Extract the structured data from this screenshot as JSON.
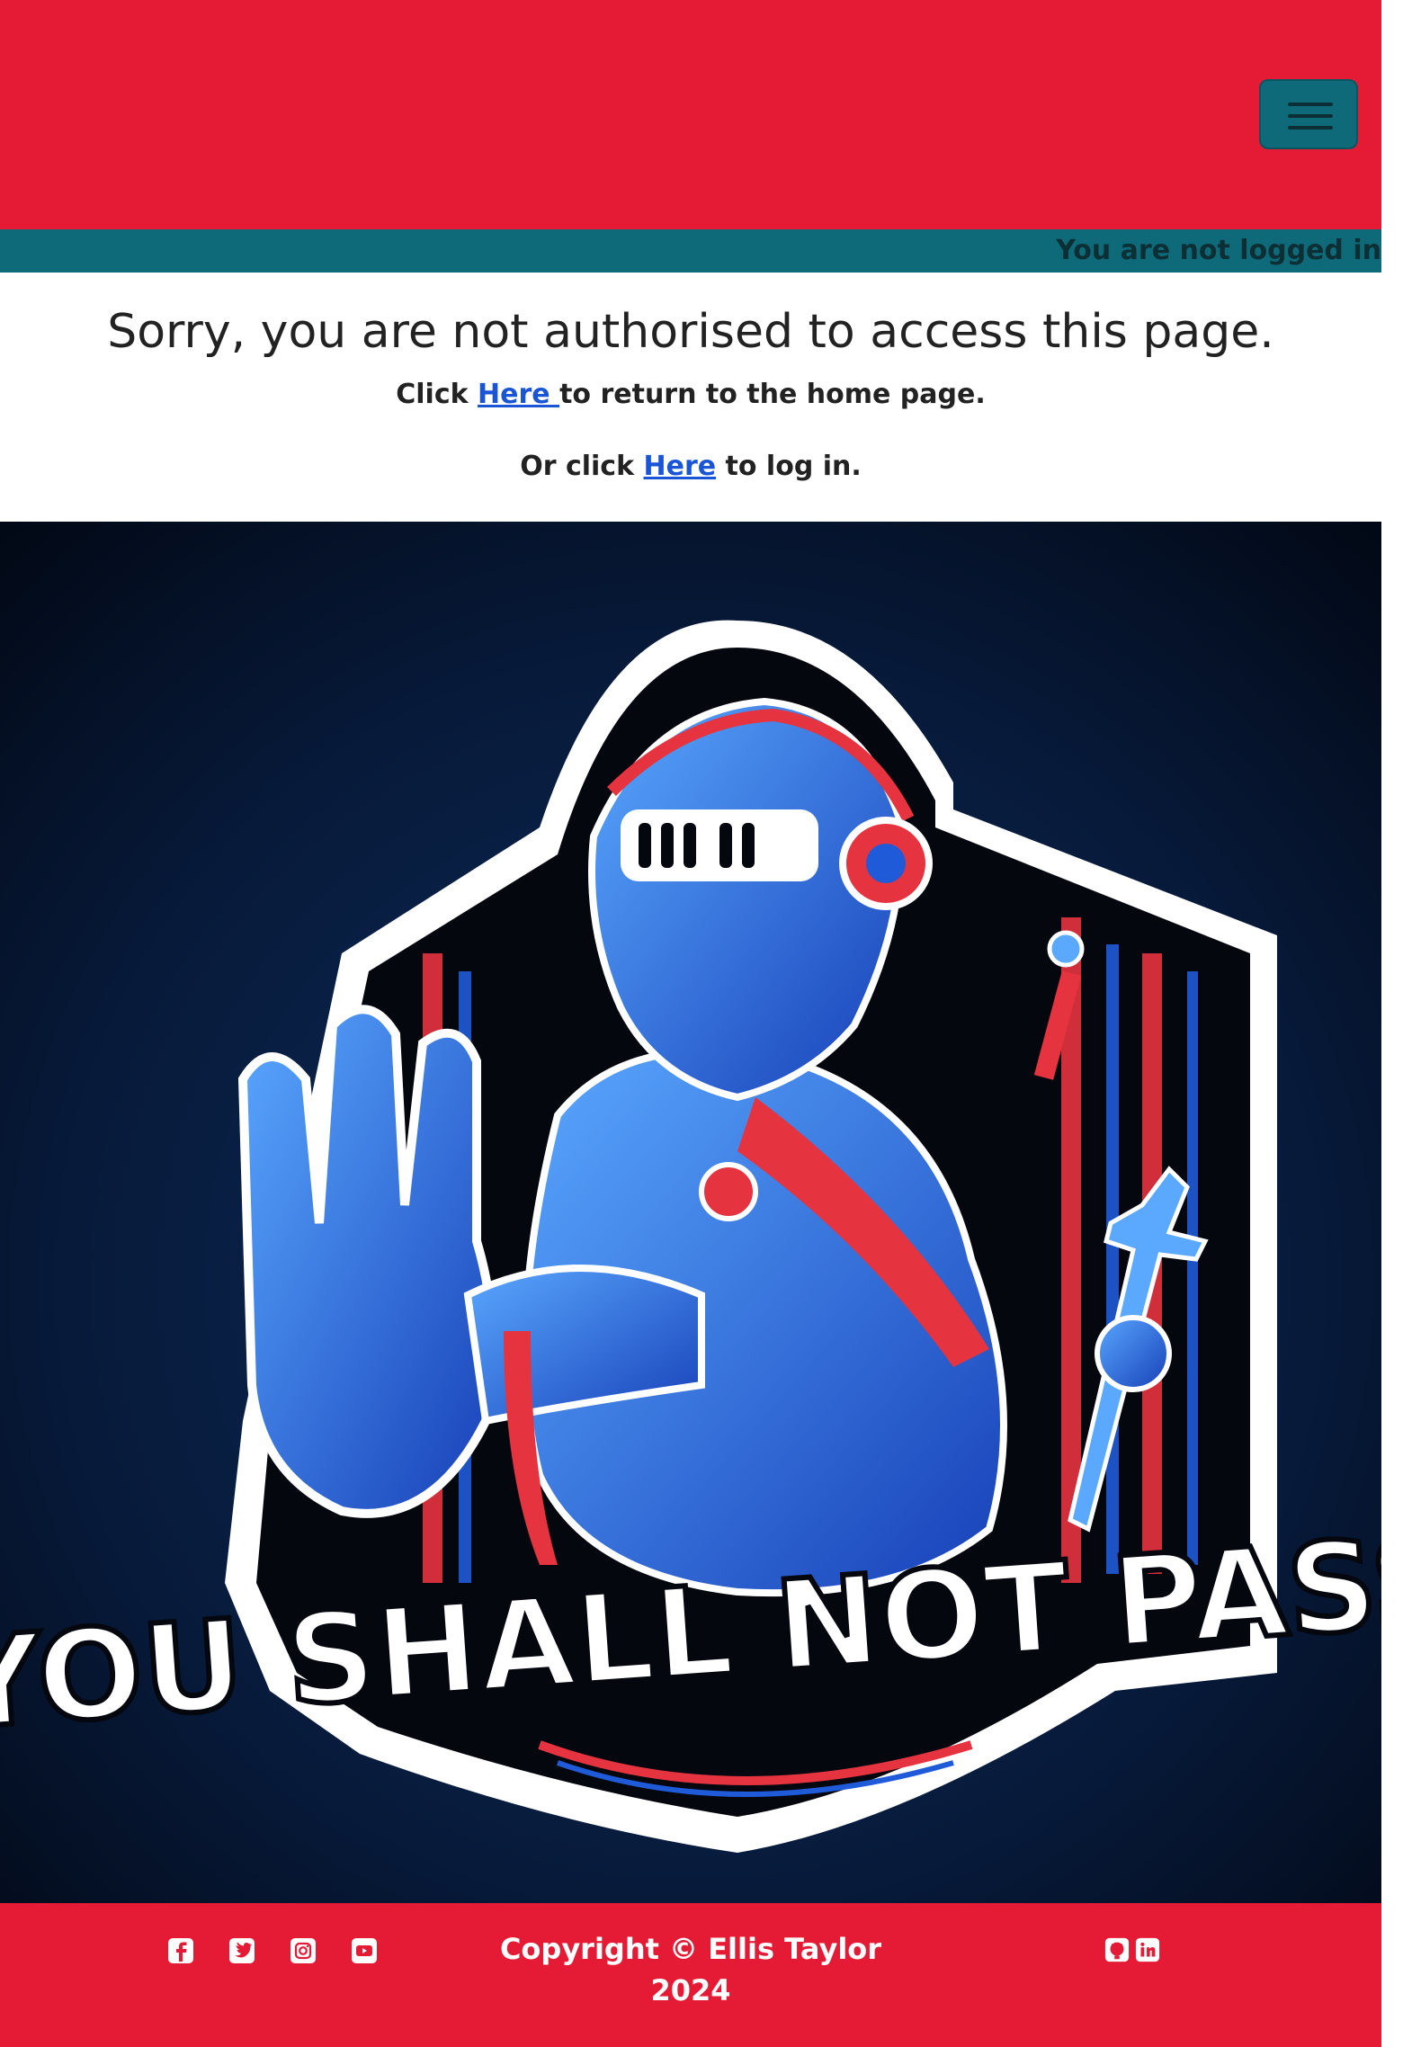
{
  "header": {
    "menu_icon": "hamburger-icon",
    "brand_color": "#e51b35",
    "accent_color": "#0e6a78"
  },
  "status": {
    "text": "You are not logged in"
  },
  "main": {
    "heading": "Sorry, you are not authorised to access this page.",
    "line1_prefix": "Click ",
    "line1_link": "Here ",
    "line1_suffix": "to return to the home page.",
    "line2_prefix": "Or click ",
    "line2_link": "Here",
    "line2_suffix": " to log in."
  },
  "hero": {
    "banner_text": "YOU SHALL NOT PASS!"
  },
  "footer": {
    "social_icons": [
      "facebook-icon",
      "twitter-icon",
      "instagram-icon",
      "youtube-icon"
    ],
    "copyright_line1": "Copyright © Ellis Taylor",
    "copyright_line2": "2024",
    "dev_icons": [
      "github-icon",
      "linkedin-icon"
    ]
  }
}
